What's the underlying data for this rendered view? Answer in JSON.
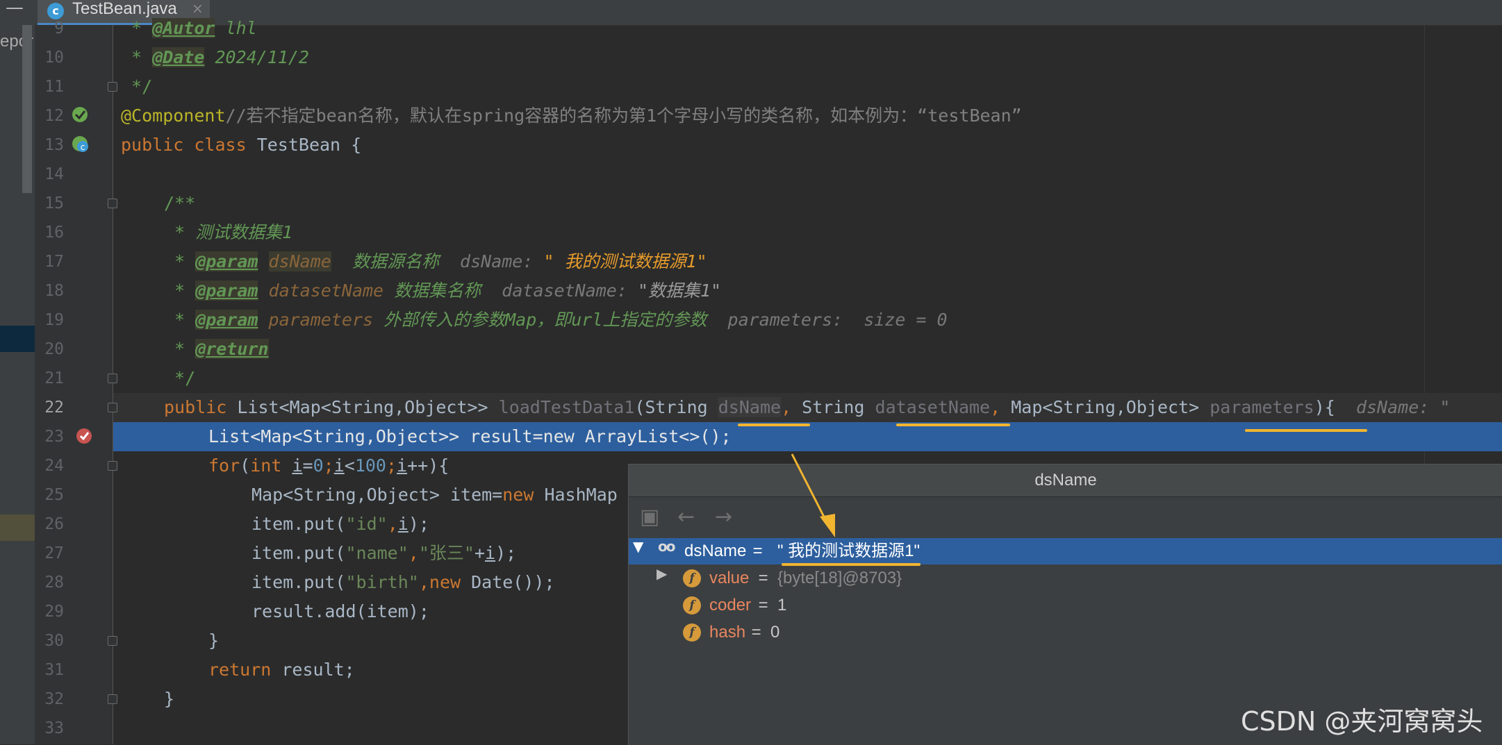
{
  "tab": {
    "icon_letter": "c",
    "filename": "TestBean.java",
    "close": "×"
  },
  "panel": {
    "text": "epor"
  },
  "lines": [
    {
      "n": "9"
    },
    {
      "n": "10"
    },
    {
      "n": "11"
    },
    {
      "n": "12"
    },
    {
      "n": "13"
    },
    {
      "n": "14"
    },
    {
      "n": "15"
    },
    {
      "n": "16"
    },
    {
      "n": "17"
    },
    {
      "n": "18"
    },
    {
      "n": "19"
    },
    {
      "n": "20"
    },
    {
      "n": "21"
    },
    {
      "n": "22"
    },
    {
      "n": "23"
    },
    {
      "n": "24"
    },
    {
      "n": "25"
    },
    {
      "n": "26"
    },
    {
      "n": "27"
    },
    {
      "n": "28"
    },
    {
      "n": "29"
    },
    {
      "n": "30"
    },
    {
      "n": "31"
    },
    {
      "n": "32"
    },
    {
      "n": "33"
    }
  ],
  "code": {
    "l9": {
      "star": " * ",
      "tag": "@Autor",
      "rest": " lhl"
    },
    "l10": {
      "star": " * ",
      "tag": "@Date",
      "rest": " 2024/11/2"
    },
    "l11": {
      "text": " */"
    },
    "l12": {
      "ann": "@Component",
      "comment": "//若不指定bean名称，默认在spring容器的名称为第1个字母小写的类名称，如本例为：“testBean”"
    },
    "l13": {
      "kw1": "public",
      "kw2": "class",
      "name": "TestBean {"
    },
    "l15": {
      "text": "/**"
    },
    "l16": {
      "text": " * 测试数据集1"
    },
    "l17": {
      "star": " * ",
      "tag": "@param",
      "param": "dsName",
      "desc": "  数据源名称",
      "inl_label": "  dsName: ",
      "inl_val": "\" 我的测试数据源1\""
    },
    "l18": {
      "star": " * ",
      "tag": "@param",
      "param": "datasetName",
      "desc": " 数据集名称",
      "inl_label": "  datasetName: ",
      "inl_val": "\"数据集1\""
    },
    "l19": {
      "star": " * ",
      "tag": "@param",
      "param": "parameters",
      "desc": " 外部传入的参数Map，即url上指定的参数",
      "inl_label": "  parameters:  size = 0"
    },
    "l20": {
      "star": " * ",
      "tag": "@return"
    },
    "l21": {
      "text": " */"
    },
    "l22": {
      "kw": "public",
      "type": " List<Map<String,Object>> ",
      "method": "loadTestData1",
      "p1": "(String ",
      "a1": "dsName",
      "comma1": ",",
      "p2": " String ",
      "a2": "datasetName",
      "comma2": ",",
      "p3": " Map<String,Object> ",
      "a3": "parameters",
      "close": "){",
      "inl": "  dsName: \""
    },
    "l23": {
      "text": "List<Map<String,Object>> result=new ArrayList<>();"
    },
    "l24": {
      "kw": "for",
      "p1": "(",
      "kw2": "int",
      "sp": " ",
      "i1": "i",
      "eq": "=",
      "zero": "0",
      "semi1": ";",
      "i2": "i",
      "lt": "<",
      "hundred": "100",
      "semi2": ";",
      "i3": "i",
      "inc": "++){"
    },
    "l25": {
      "text": "Map<String,Object> item=",
      "kw": "new",
      "rest": " HashMap"
    },
    "l26": {
      "pre": "item.put(",
      "s": "\"id\"",
      "c": ",",
      "i": "i",
      "post": ");"
    },
    "l27": {
      "pre": "item.put(",
      "s1": "\"name\"",
      "c": ",",
      "s2": "\"张三\"",
      "plus": "+",
      "i": "i",
      "post": ");"
    },
    "l28": {
      "pre": "item.put(",
      "s": "\"birth\"",
      "c": ",",
      "kw": "new",
      "post": " Date());"
    },
    "l29": {
      "text": "result.add(item);"
    },
    "l30": {
      "text": "}"
    },
    "l31": {
      "kw": "return",
      "rest": " result;"
    },
    "l32": {
      "text": "}"
    }
  },
  "debugger_popup": {
    "title": "dsName",
    "toolbar": {
      "folder": "▣",
      "back": "←",
      "forward": "→"
    },
    "root": {
      "toggle": "▼",
      "icon": "oo",
      "name": "dsName",
      "eq": " = ",
      "value": "\" 我的测试数据源1\""
    },
    "children": [
      {
        "toggle": "▶",
        "icon": "f",
        "name": "value",
        "eq": " = ",
        "value": "{byte[18]@8703}"
      },
      {
        "toggle": "",
        "icon": "f",
        "name": "coder",
        "eq": " = ",
        "value": "1"
      },
      {
        "toggle": "",
        "icon": "f",
        "name": "hash",
        "eq": " = ",
        "value": "0"
      }
    ]
  },
  "watermark": "CSDN @夹河窝窝头",
  "colors": {
    "accent": "#2d5f9e",
    "annotation_underline": "#f2b530",
    "breakpoint": "#c75450"
  }
}
